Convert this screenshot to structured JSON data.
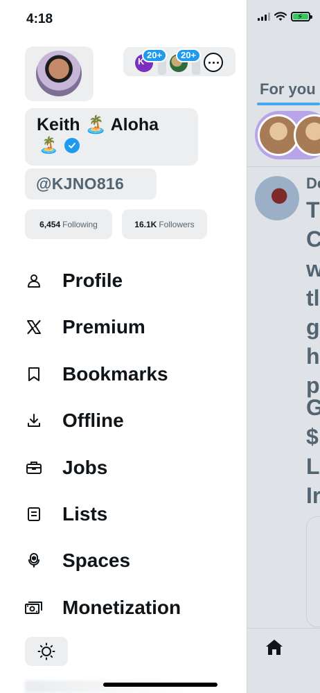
{
  "status_bar": {
    "time": "4:18"
  },
  "profile": {
    "name_line1": "Keith 🏝️ Aloha",
    "name_line2_emoji": "🏝️",
    "handle": "@KJNO816",
    "following_count": "6,454",
    "following_label": "Following",
    "followers_count": "16.1K",
    "followers_label": "Followers",
    "verified_icon": "verified-badge-icon"
  },
  "accounts": {
    "account1_initial": "K",
    "account1_badge": "20+",
    "account2_badge": "20+",
    "more_icon": "more-horizontal-icon"
  },
  "menu": [
    {
      "label": "Profile",
      "icon": "person-icon"
    },
    {
      "label": "Premium",
      "icon": "x-logo-icon"
    },
    {
      "label": "Bookmarks",
      "icon": "bookmark-icon"
    },
    {
      "label": "Offline",
      "icon": "download-icon"
    },
    {
      "label": "Jobs",
      "icon": "briefcase-icon"
    },
    {
      "label": "Lists",
      "icon": "list-icon"
    },
    {
      "label": "Spaces",
      "icon": "microphone-icon"
    },
    {
      "label": "Monetization",
      "icon": "money-icon"
    }
  ],
  "theme_icon": "sun-icon",
  "background_timeline": {
    "tab_label": "For you",
    "post_partial_name": "De",
    "post_partial_letters": [
      "T",
      "C",
      "w",
      "tl",
      "g",
      "h",
      "p",
      "G",
      "$",
      "Li",
      "Ir"
    ],
    "home_icon": "home-icon"
  },
  "colors": {
    "accent": "#1d9bf0",
    "text": "#0f1419",
    "muted": "#536471",
    "chip_bg": "#eceef0"
  }
}
